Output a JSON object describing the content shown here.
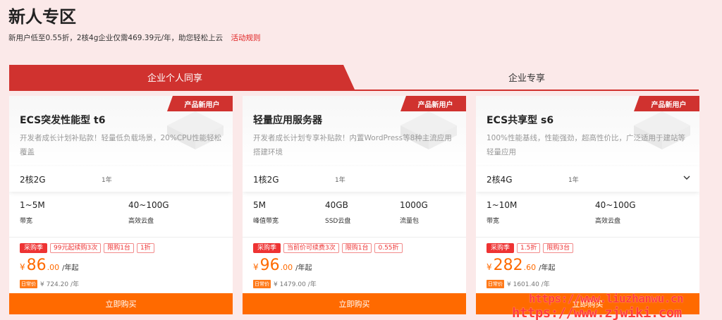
{
  "header": {
    "title": "新人专区",
    "subtitle": "新用户低至0.55折，2核4g企业仅需469.39元/年，助您轻松上云",
    "rules_link": "活动规则"
  },
  "tabs": [
    {
      "label": "企业个人同享",
      "active": true
    },
    {
      "label": "企业专享",
      "active": false
    }
  ],
  "colors": {
    "accent": "#d0322f",
    "price": "#ff6a00",
    "background": "#fbe9e9"
  },
  "cards": [
    {
      "ribbon": "产品新用户",
      "name": "ECS突发性能型 t6",
      "desc": "开发者成长计划补贴款！轻量低负载场景，20%CPU性能轻松覆盖",
      "config": "2核2G",
      "term": "1年",
      "specs": [
        {
          "value": "1~5M",
          "label": "带宽"
        },
        {
          "value": "40~100G",
          "label": "高效云盘"
        }
      ],
      "promo_tag": "采购季",
      "tags": [
        "99元起续购3次",
        "限购1台",
        "1折"
      ],
      "price_symbol": "¥",
      "price_int": "86",
      "price_dec": ".00",
      "price_unit": "/年起",
      "daily_badge": "日常价",
      "daily_price": "¥ 724.20 /年",
      "buy": "立即购买"
    },
    {
      "ribbon": "产品新用户",
      "name": "轻量应用服务器",
      "desc": "开发者成长计划专享补贴款！内置WordPress等8种主流应用搭建环境",
      "config": "1核2G",
      "term": "1年",
      "specs": [
        {
          "value": "5M",
          "label": "峰值带宽"
        },
        {
          "value": "40GB",
          "label": "SSD云盘"
        },
        {
          "value": "1000G",
          "label": "流量包"
        }
      ],
      "promo_tag": "采购季",
      "tags": [
        "当前价可续费3次",
        "限购1台",
        "0.55折"
      ],
      "price_symbol": "¥",
      "price_int": "96",
      "price_dec": ".00",
      "price_unit": "/年起",
      "daily_badge": "日常价",
      "daily_price": "¥ 1479.00 /年",
      "buy": "立即购买"
    },
    {
      "ribbon": "产品新用户",
      "name": "ECS共享型 s6",
      "desc": "100%性能基线，性能强劲，超高性价比，广泛适用于建站等轻量应用",
      "config": "2核4G",
      "term": "1年",
      "specs": [
        {
          "value": "1~10M",
          "label": "带宽"
        },
        {
          "value": "40~100G",
          "label": "高效云盘"
        }
      ],
      "promo_tag": "采购季",
      "tags": [
        "1.5折",
        "限购3台"
      ],
      "price_symbol": "¥",
      "price_int": "282",
      "price_dec": ".60",
      "price_unit": "/年起",
      "daily_badge": "日常价",
      "daily_price": "¥ 1601.40 /年",
      "buy": "立即购买"
    }
  ],
  "watermark": {
    "line1": "https://www.liuzhanwu.cn",
    "line2": "https://www.zjwiki.com"
  }
}
